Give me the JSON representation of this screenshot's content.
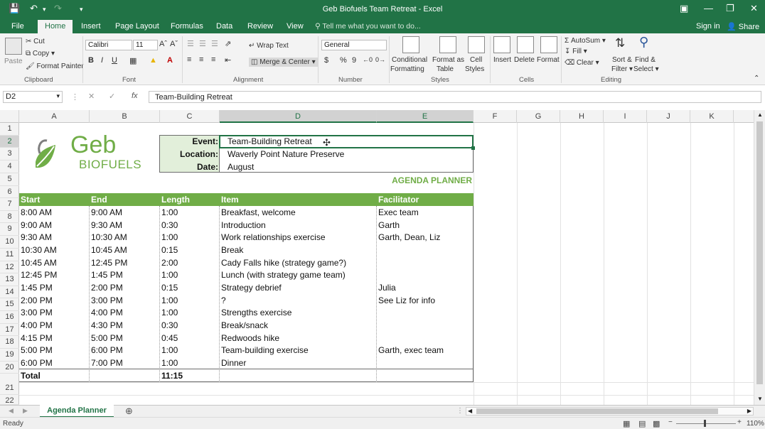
{
  "window": {
    "title": "Geb Biofuels Team Retreat - Excel"
  },
  "tabs": {
    "file": "File",
    "home": "Home",
    "insert": "Insert",
    "page_layout": "Page Layout",
    "formulas": "Formulas",
    "data": "Data",
    "review": "Review",
    "view": "View",
    "tell_me": "Tell me what you want to do...",
    "sign_in": "Sign in",
    "share": "Share"
  },
  "ribbon": {
    "clipboard": {
      "paste": "Paste",
      "cut": "Cut",
      "copy": "Copy",
      "format_painter": "Format Painter",
      "label": "Clipboard"
    },
    "font": {
      "name": "Calibri",
      "size": "11",
      "bold": "B",
      "italic": "I",
      "underline": "U",
      "label": "Font"
    },
    "alignment": {
      "wrap_text": "Wrap Text",
      "merge_center": "Merge & Center",
      "label": "Alignment"
    },
    "number": {
      "format": "General",
      "currency": "$",
      "percent": "%",
      "comma": "9",
      "label": "Number"
    },
    "styles": {
      "conditional_1": "Conditional",
      "conditional_2": "Formatting",
      "format_as_1": "Format as",
      "format_as_2": "Table",
      "cell_styles_1": "Cell",
      "cell_styles_2": "Styles",
      "label": "Styles"
    },
    "cells": {
      "insert": "Insert",
      "delete": "Delete",
      "format": "Format",
      "label": "Cells"
    },
    "editing": {
      "autosum": "AutoSum",
      "fill": "Fill",
      "clear": "Clear",
      "sort_1": "Sort &",
      "sort_2": "Filter",
      "find_1": "Find &",
      "find_2": "Select",
      "label": "Editing"
    }
  },
  "formula_bar": {
    "name_box": "D2",
    "fx": "fx",
    "content": "Team-Building Retreat"
  },
  "columns": [
    "A",
    "B",
    "C",
    "D",
    "E",
    "F",
    "G",
    "H",
    "I",
    "J",
    "K"
  ],
  "rows": [
    "1",
    "2",
    "3",
    "4",
    "5",
    "6",
    "7",
    "8",
    "9",
    "10",
    "11",
    "12",
    "13",
    "14",
    "15",
    "16",
    "17",
    "18",
    "19",
    "20",
    "21",
    "22"
  ],
  "logo": {
    "name_top": "Geb",
    "name_bottom": "BIOFUELS"
  },
  "event_box": {
    "event_label": "Event:",
    "event_value": "Team-Building Retreat",
    "location_label": "Location:",
    "location_value": "Waverly Point Nature Preserve",
    "date_label": "Date:",
    "date_value": "August"
  },
  "agenda_title": "AGENDA PLANNER",
  "table": {
    "headers": [
      "Start",
      "End",
      "Length",
      "Item",
      "Facilitator"
    ],
    "rows": [
      [
        "8:00 AM",
        "9:00 AM",
        "1:00",
        "Breakfast, welcome",
        "Exec team"
      ],
      [
        "9:00 AM",
        "9:30 AM",
        "0:30",
        "Introduction",
        "Garth"
      ],
      [
        "9:30 AM",
        "10:30 AM",
        "1:00",
        "Work relationships exercise",
        "Garth, Dean, Liz"
      ],
      [
        "10:30 AM",
        "10:45 AM",
        "0:15",
        "Break",
        ""
      ],
      [
        "10:45 AM",
        "12:45 PM",
        "2:00",
        "Cady Falls hike (strategy game?)",
        ""
      ],
      [
        "12:45 PM",
        "1:45 PM",
        "1:00",
        "Lunch (with strategy game team)",
        ""
      ],
      [
        "1:45 PM",
        "2:00 PM",
        "0:15",
        "Strategy debrief",
        "Julia"
      ],
      [
        "2:00 PM",
        "3:00 PM",
        "1:00",
        "?",
        "See Liz for info"
      ],
      [
        "3:00 PM",
        "4:00 PM",
        "1:00",
        "Strengths exercise",
        ""
      ],
      [
        "4:00 PM",
        "4:30 PM",
        "0:30",
        "Break/snack",
        ""
      ],
      [
        "4:15 PM",
        "5:00 PM",
        "0:45",
        "Redwoods hike",
        ""
      ],
      [
        "5:00 PM",
        "6:00 PM",
        "1:00",
        "Team-building exercise",
        "Garth, exec team"
      ],
      [
        "6:00 PM",
        "7:00 PM",
        "1:00",
        "Dinner",
        ""
      ]
    ],
    "total_label": "Total",
    "total_value": "11:15"
  },
  "sheet_tab": "Agenda Planner",
  "status": {
    "ready": "Ready",
    "zoom": "110%"
  },
  "colors": {
    "excel_green": "#217346",
    "table_header": "#70ad47",
    "event_bg": "#e2efda",
    "agenda_title": "#70ad47"
  }
}
